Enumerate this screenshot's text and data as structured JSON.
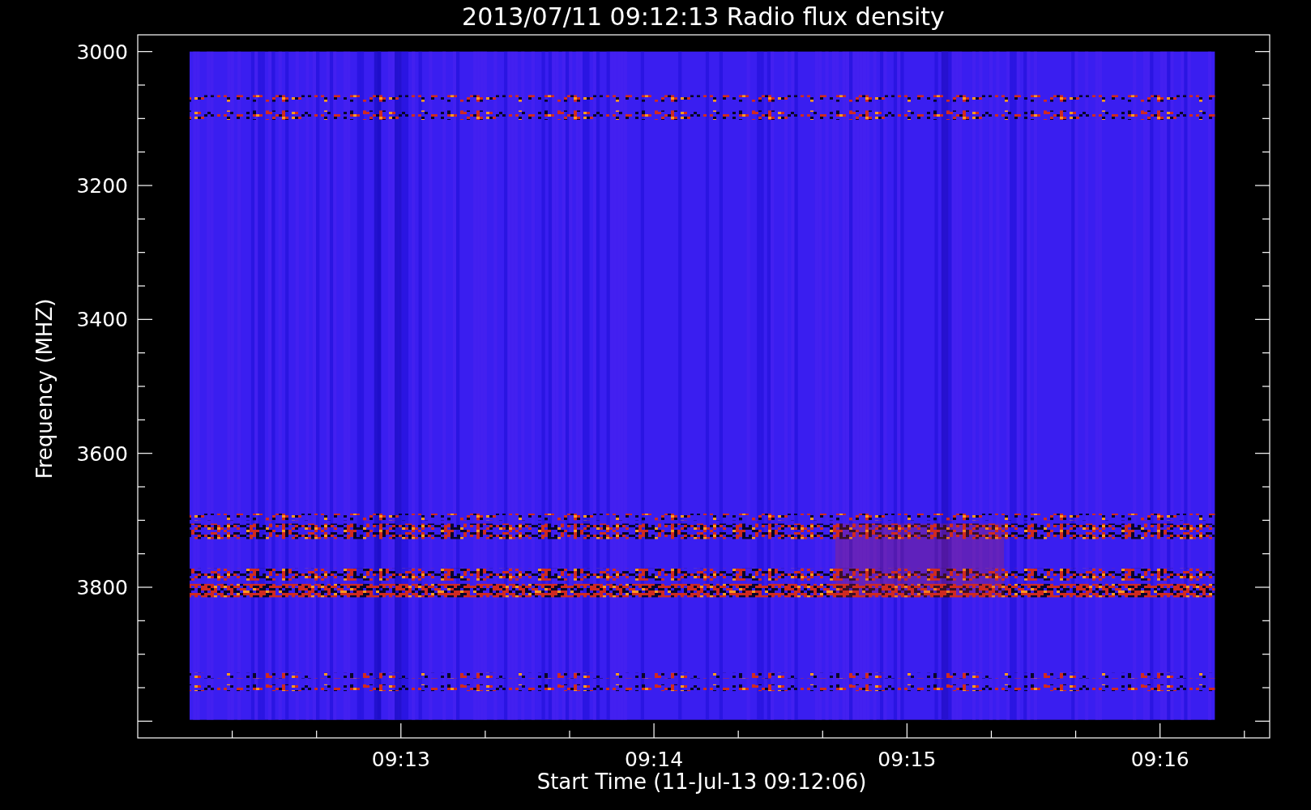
{
  "title": "2013/07/11 09:12:13 Radio flux density",
  "y_axis": {
    "label": "Frequency (MHZ)",
    "ticks": [
      {
        "label": "3000"
      },
      {
        "label": "3200"
      },
      {
        "label": "3400"
      },
      {
        "label": "3600"
      },
      {
        "label": "3800"
      }
    ]
  },
  "x_axis": {
    "label": "Start Time (11-Jul-13 09:12:06)",
    "ticks": [
      {
        "label": "09:13"
      },
      {
        "label": "09:14"
      },
      {
        "label": "09:15"
      },
      {
        "label": "09:16"
      }
    ]
  }
}
